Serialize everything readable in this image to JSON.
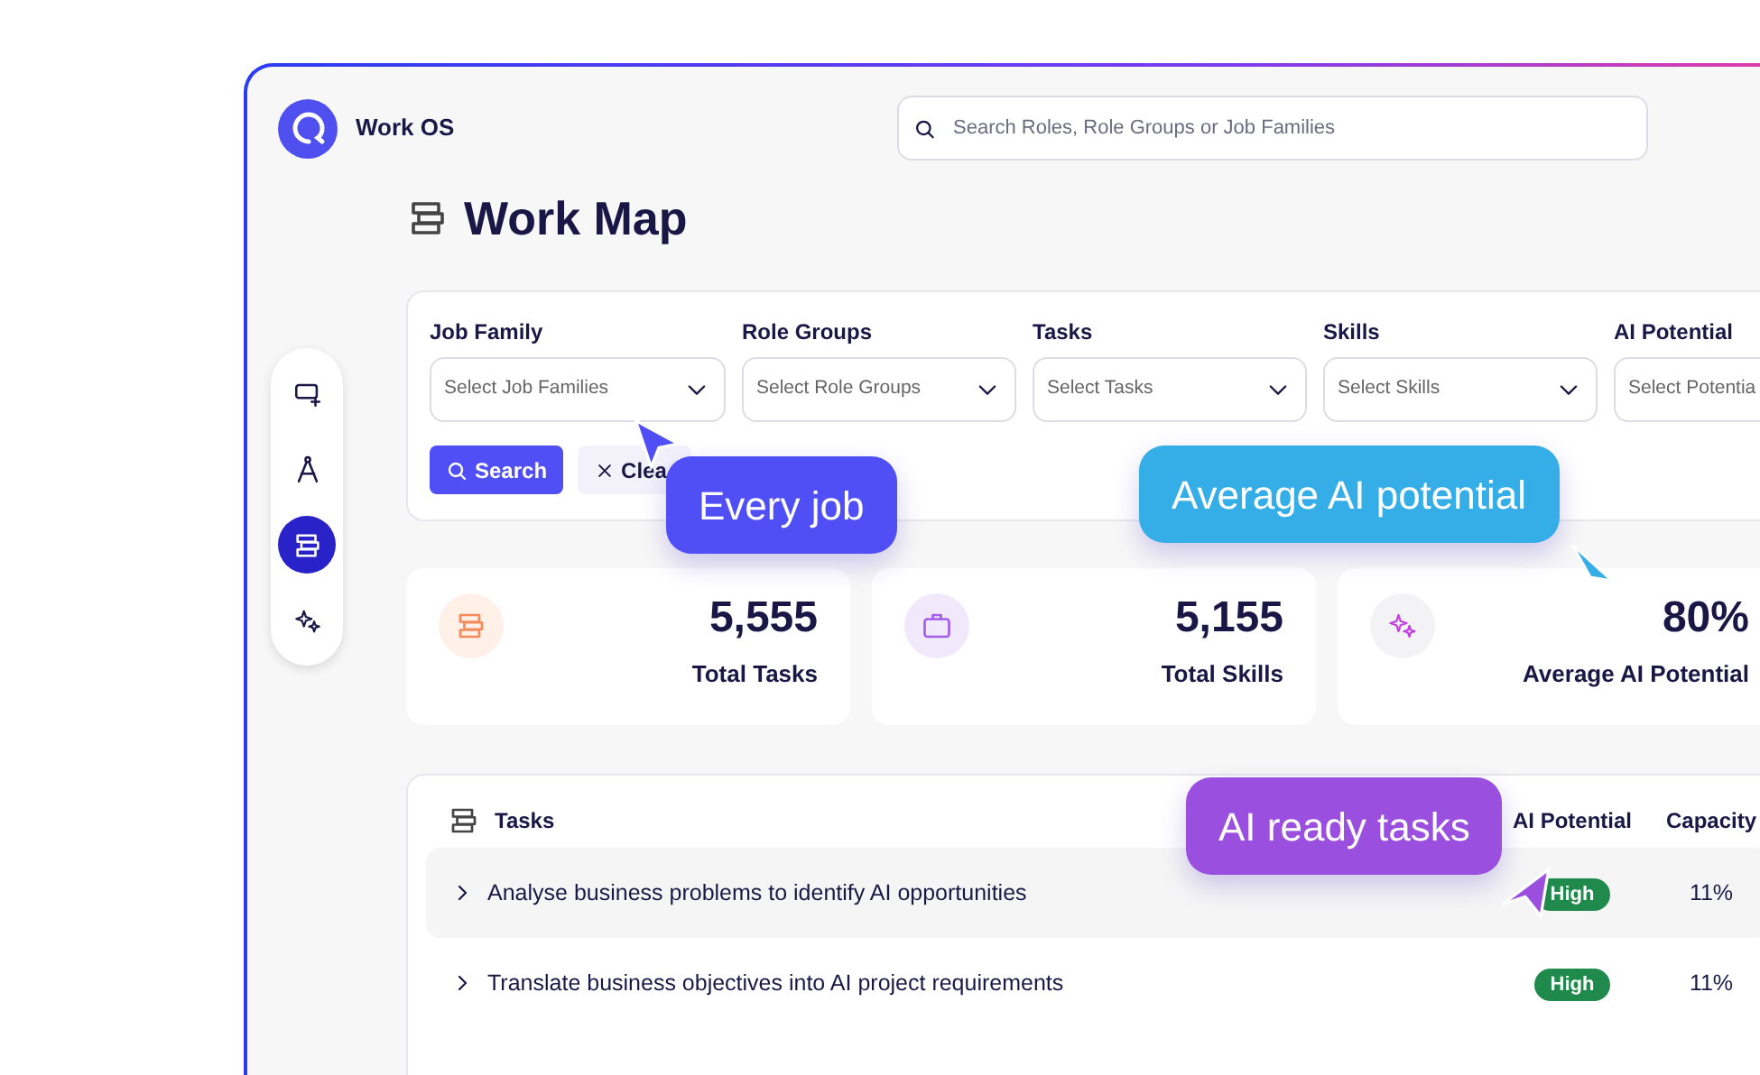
{
  "app": {
    "name": "Work OS"
  },
  "search": {
    "placeholder": "Search Roles, Role Groups or Job Families"
  },
  "page_title": "Work Map",
  "sidebar": {
    "items": [
      {
        "selected": false
      },
      {
        "selected": false
      },
      {
        "selected": true
      },
      {
        "selected": false
      }
    ]
  },
  "filters": [
    {
      "label": "Job Family",
      "placeholder": "Select Job Families"
    },
    {
      "label": "Role Groups",
      "placeholder": "Select Role Groups"
    },
    {
      "label": "Tasks",
      "placeholder": "Select Tasks"
    },
    {
      "label": "Skills",
      "placeholder": "Select Skills"
    },
    {
      "label": "AI Potential",
      "placeholder": "Select Potentia"
    }
  ],
  "buttons": {
    "search": "Search",
    "clear": "Clea"
  },
  "stats": [
    {
      "value": "5,555",
      "label": "Total Tasks"
    },
    {
      "value": "5,155",
      "label": "Total Skills"
    },
    {
      "value": "80%",
      "label": "Average AI Potential"
    }
  ],
  "tasks": {
    "title": "Tasks",
    "columns": [
      "AI Potential",
      "Capacity"
    ],
    "rows": [
      {
        "title": "Analyse business problems to identify AI opportunities",
        "ai_potential": "High",
        "capacity": "11%",
        "expanded": false
      },
      {
        "title": "Translate business objectives into AI project requirements",
        "ai_potential": "High",
        "capacity": "11%",
        "expanded": false
      }
    ]
  },
  "callouts": [
    {
      "text": "Every job",
      "color": "#4f4ff5"
    },
    {
      "text": "Average AI potential",
      "color": "#35aee8"
    },
    {
      "text": "AI ready tasks",
      "color": "#9b4fdf"
    }
  ]
}
